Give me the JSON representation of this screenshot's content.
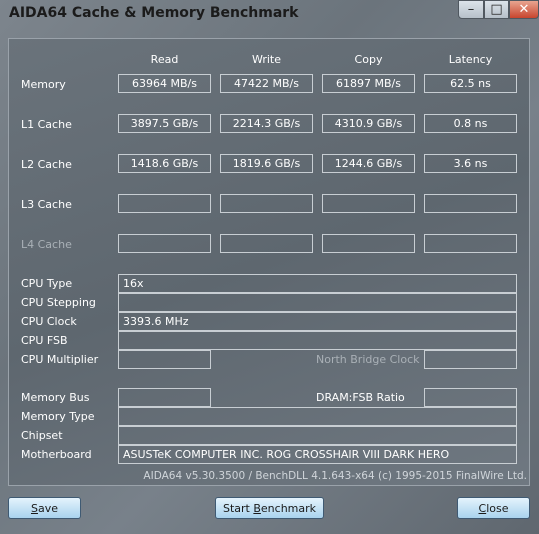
{
  "window": {
    "title": "AIDA64 Cache & Memory Benchmark",
    "min_glyph": "–",
    "max_glyph": "□",
    "close_glyph": "✕"
  },
  "columns": [
    "Read",
    "Write",
    "Copy",
    "Latency"
  ],
  "rows": [
    {
      "label": "Memory",
      "values": [
        "63964 MB/s",
        "47422 MB/s",
        "61897 MB/s",
        "62.5 ns"
      ]
    },
    {
      "label": "L1 Cache",
      "values": [
        "3897.5 GB/s",
        "2214.3 GB/s",
        "4310.9 GB/s",
        "0.8 ns"
      ]
    },
    {
      "label": "L2 Cache",
      "values": [
        "1418.6 GB/s",
        "1819.6 GB/s",
        "1244.6 GB/s",
        "3.6 ns"
      ]
    },
    {
      "label": "L3 Cache",
      "values": [
        "",
        "",
        "",
        ""
      ]
    },
    {
      "label": "L4 Cache",
      "values": [
        "",
        "",
        "",
        ""
      ]
    }
  ],
  "info": {
    "cpu_type": {
      "label": "CPU Type",
      "value": "16x"
    },
    "cpu_stepping": {
      "label": "CPU Stepping",
      "value": ""
    },
    "cpu_clock": {
      "label": "CPU Clock",
      "value": "3393.6 MHz"
    },
    "cpu_fsb": {
      "label": "CPU FSB",
      "value": ""
    },
    "cpu_multiplier": {
      "label": "CPU Multiplier",
      "value": ""
    },
    "north_bridge_clock": {
      "label": "North Bridge Clock",
      "value": ""
    },
    "memory_bus": {
      "label": "Memory Bus",
      "value": ""
    },
    "dram_fsb_ratio": {
      "label": "DRAM:FSB Ratio",
      "value": ""
    },
    "memory_type": {
      "label": "Memory Type",
      "value": ""
    },
    "chipset": {
      "label": "Chipset",
      "value": ""
    },
    "motherboard": {
      "label": "Motherboard",
      "value": "ASUSTeK COMPUTER INC. ROG CROSSHAIR VIII DARK HERO"
    }
  },
  "footer": "AIDA64 v5.30.3500 / BenchDLL 4.1.643-x64  (c) 1995-2015 FinalWire Ltd.",
  "buttons": {
    "save_u": "S",
    "save_rest": "ave",
    "start_pre": "Start ",
    "start_u": "B",
    "start_rest": "enchmark",
    "close_u": "C",
    "close_rest": "lose"
  }
}
